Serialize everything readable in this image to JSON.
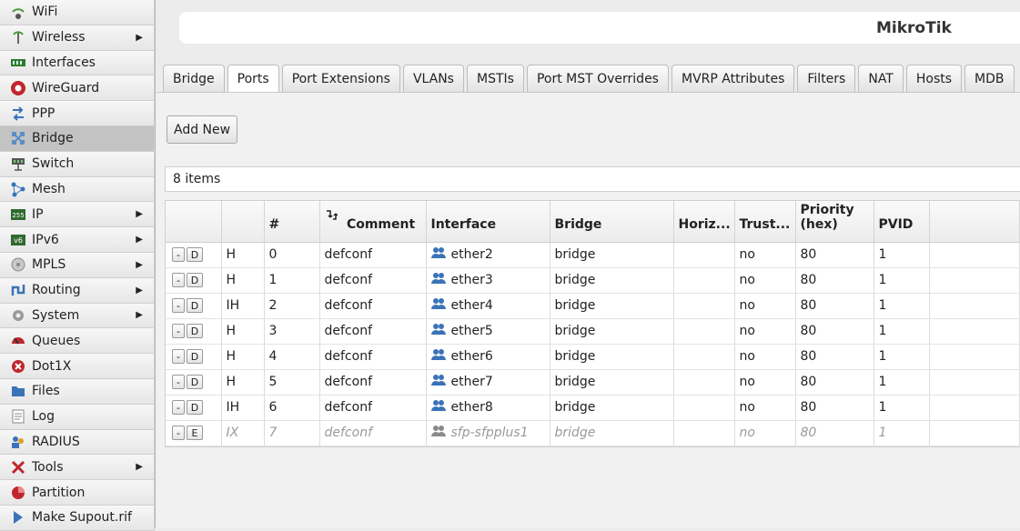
{
  "sidebar": {
    "items": [
      {
        "label": "WiFi",
        "icon": "wifi-icon",
        "arrow": ""
      },
      {
        "label": "Wireless",
        "icon": "wireless-icon",
        "arrow": "▶"
      },
      {
        "label": "Interfaces",
        "icon": "interfaces-icon",
        "arrow": ""
      },
      {
        "label": "WireGuard",
        "icon": "wireguard-icon",
        "arrow": ""
      },
      {
        "label": "PPP",
        "icon": "ppp-icon",
        "arrow": ""
      },
      {
        "label": "Bridge",
        "icon": "bridge-icon",
        "arrow": ""
      },
      {
        "label": "Switch",
        "icon": "switch-icon",
        "arrow": ""
      },
      {
        "label": "Mesh",
        "icon": "mesh-icon",
        "arrow": ""
      },
      {
        "label": "IP",
        "icon": "ip-icon",
        "arrow": "▶"
      },
      {
        "label": "IPv6",
        "icon": "ipv6-icon",
        "arrow": "▶"
      },
      {
        "label": "MPLS",
        "icon": "mpls-icon",
        "arrow": "▶"
      },
      {
        "label": "Routing",
        "icon": "routing-icon",
        "arrow": "▶"
      },
      {
        "label": "System",
        "icon": "system-icon",
        "arrow": "▶"
      },
      {
        "label": "Queues",
        "icon": "queues-icon",
        "arrow": ""
      },
      {
        "label": "Dot1X",
        "icon": "dot1x-icon",
        "arrow": ""
      },
      {
        "label": "Files",
        "icon": "files-icon",
        "arrow": ""
      },
      {
        "label": "Log",
        "icon": "log-icon",
        "arrow": ""
      },
      {
        "label": "RADIUS",
        "icon": "radius-icon",
        "arrow": ""
      },
      {
        "label": "Tools",
        "icon": "tools-icon",
        "arrow": "▶"
      },
      {
        "label": "Partition",
        "icon": "partition-icon",
        "arrow": ""
      },
      {
        "label": "Make Supout.rif",
        "icon": "supout-icon",
        "arrow": ""
      }
    ],
    "active": "Bridge"
  },
  "header": {
    "brand": "MikroTik"
  },
  "tabs": [
    "Bridge",
    "Ports",
    "Port Extensions",
    "VLANs",
    "MSTIs",
    "Port MST Overrides",
    "MVRP Attributes",
    "Filters",
    "NAT",
    "Hosts",
    "MDB"
  ],
  "active_tab": "Ports",
  "toolbar": {
    "add_new": "Add New"
  },
  "items_count": "8 items",
  "table": {
    "columns": {
      "num": "#",
      "comment": "Comment",
      "interface": "Interface",
      "bridge": "Bridge",
      "horizon": "Horiz...",
      "trusted": "Trust...",
      "priority_line1": "Priority",
      "priority_line2": "(hex)",
      "pvid": "PVID"
    },
    "rows": [
      {
        "remove": "-",
        "toggle": "D",
        "flags": "H",
        "num": "0",
        "comment": "defconf",
        "interface": "ether2",
        "bridge": "bridge",
        "horizon": "",
        "trusted": "no",
        "priority": "80",
        "pvid": "1",
        "disabled": false
      },
      {
        "remove": "-",
        "toggle": "D",
        "flags": "H",
        "num": "1",
        "comment": "defconf",
        "interface": "ether3",
        "bridge": "bridge",
        "horizon": "",
        "trusted": "no",
        "priority": "80",
        "pvid": "1",
        "disabled": false
      },
      {
        "remove": "-",
        "toggle": "D",
        "flags": "IH",
        "num": "2",
        "comment": "defconf",
        "interface": "ether4",
        "bridge": "bridge",
        "horizon": "",
        "trusted": "no",
        "priority": "80",
        "pvid": "1",
        "disabled": false
      },
      {
        "remove": "-",
        "toggle": "D",
        "flags": "H",
        "num": "3",
        "comment": "defconf",
        "interface": "ether5",
        "bridge": "bridge",
        "horizon": "",
        "trusted": "no",
        "priority": "80",
        "pvid": "1",
        "disabled": false
      },
      {
        "remove": "-",
        "toggle": "D",
        "flags": "H",
        "num": "4",
        "comment": "defconf",
        "interface": "ether6",
        "bridge": "bridge",
        "horizon": "",
        "trusted": "no",
        "priority": "80",
        "pvid": "1",
        "disabled": false
      },
      {
        "remove": "-",
        "toggle": "D",
        "flags": "H",
        "num": "5",
        "comment": "defconf",
        "interface": "ether7",
        "bridge": "bridge",
        "horizon": "",
        "trusted": "no",
        "priority": "80",
        "pvid": "1",
        "disabled": false
      },
      {
        "remove": "-",
        "toggle": "D",
        "flags": "IH",
        "num": "6",
        "comment": "defconf",
        "interface": "ether8",
        "bridge": "bridge",
        "horizon": "",
        "trusted": "no",
        "priority": "80",
        "pvid": "1",
        "disabled": false
      },
      {
        "remove": "-",
        "toggle": "E",
        "flags": "IX",
        "num": "7",
        "comment": "defconf",
        "interface": "sfp-sfpplus1",
        "bridge": "bridge",
        "horizon": "",
        "trusted": "no",
        "priority": "80",
        "pvid": "1",
        "disabled": true
      }
    ]
  },
  "colors": {
    "active_iface_icon": "#3a73b8",
    "disabled_iface_icon": "#8a8a8a",
    "disabled_text": "#9a9a9a"
  }
}
